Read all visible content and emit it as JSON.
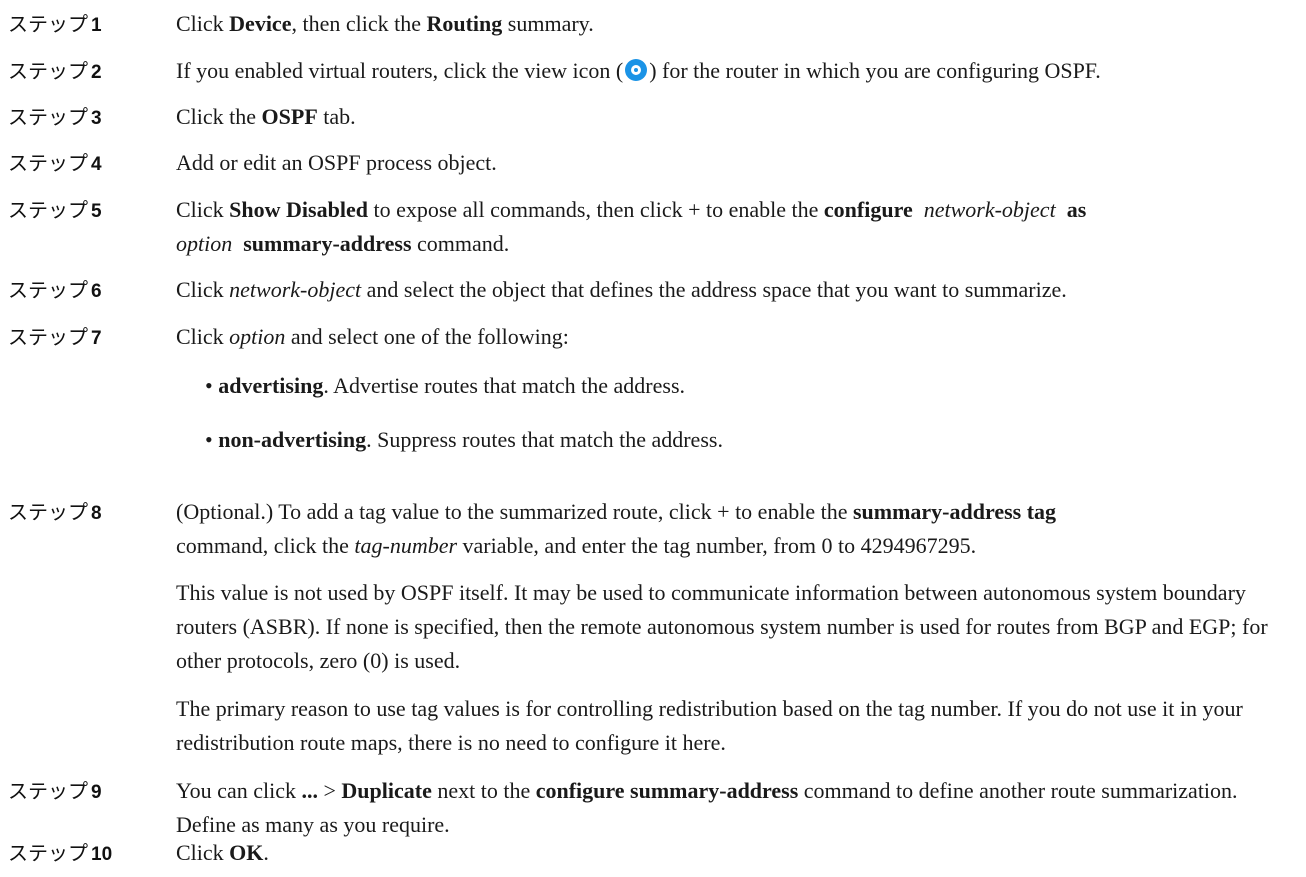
{
  "step_prefix": "ステップ",
  "steps": [
    {
      "num": "1",
      "p": [
        "Click ",
        "Device",
        ", then click the ",
        "Routing",
        " summary."
      ]
    },
    {
      "num": "2",
      "p": [
        "If you enabled virtual routers, click the view icon (",
        ") for the router in which you are configuring OSPF."
      ],
      "icon": "view-icon"
    },
    {
      "num": "3",
      "p": [
        "Click the ",
        "OSPF",
        " tab."
      ]
    },
    {
      "num": "4",
      "p": [
        "Add or edit an OSPF process object."
      ]
    },
    {
      "num": "5",
      "p": [
        "Click ",
        "Show Disabled",
        " to expose all commands, then click + to enable the ",
        "configure",
        "network-object",
        "as",
        "option",
        "summary-address",
        " command."
      ]
    },
    {
      "num": "6",
      "p": [
        "Click ",
        "network-object",
        " and select the object that defines the address space that you want to summarize."
      ]
    },
    {
      "num": "7",
      "p": [
        "Click ",
        "option",
        " and select one of the following:"
      ],
      "bullets": [
        {
          "term": "advertising",
          "text": ". Advertise routes that match the address."
        },
        {
          "term": "non-advertising",
          "text": ". Suppress routes that match the address."
        }
      ]
    },
    {
      "num": "8",
      "p": [
        "(Optional.) To add a tag value to the summarized route, click + to enable the ",
        "summary-address tag",
        " command, click the ",
        "tag-number",
        " variable, and enter the tag number, from 0 to 4294967295."
      ],
      "paras": [
        "This value is not used by OSPF itself. It may be used to communicate information between autonomous system boundary routers (ASBR). If none is specified, then the remote autonomous system number is used for routes from BGP and EGP; for other protocols, zero (0) is used.",
        "The primary reason to use tag values is for controlling redistribution based on the tag number. If you do not use it in your redistribution route maps, there is no need to configure it here."
      ]
    },
    {
      "num": "9",
      "p": [
        "You can click ",
        "...",
        " > ",
        "Duplicate",
        " next to the ",
        "configure summary-address",
        " command to define another route summarization. Define as many as you require."
      ]
    },
    {
      "num": "10",
      "p": [
        "Click ",
        "OK",
        "."
      ]
    }
  ]
}
